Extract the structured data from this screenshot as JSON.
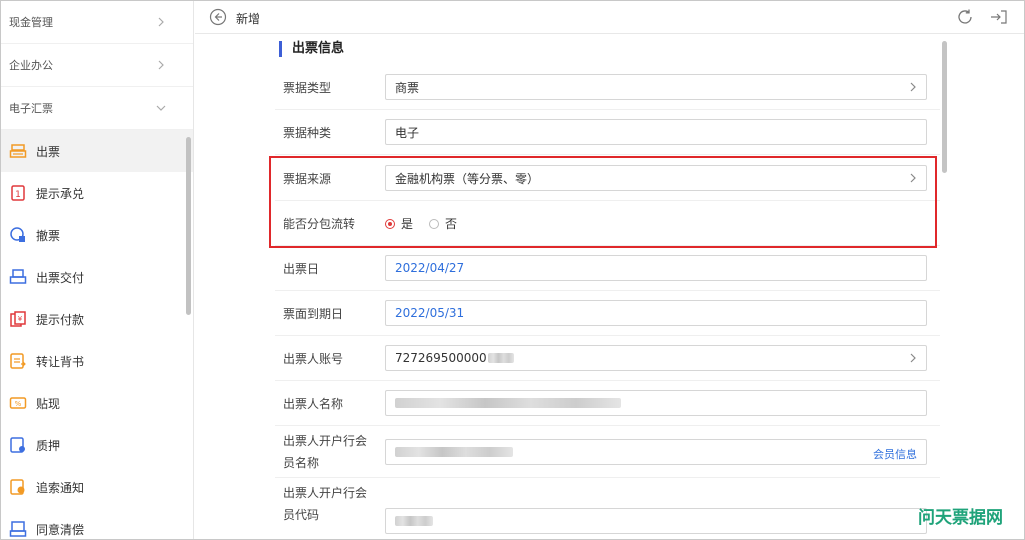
{
  "sidebar": {
    "groups": [
      {
        "label": "现金管理",
        "expanded": false
      },
      {
        "label": "企业办公",
        "expanded": false
      },
      {
        "label": "电子汇票",
        "expanded": true
      }
    ],
    "items": [
      {
        "label": "出票",
        "icon": "issue-bill-icon",
        "active": true
      },
      {
        "label": "提示承兑",
        "icon": "acceptance-prompt-icon",
        "active": false
      },
      {
        "label": "撤票",
        "icon": "revoke-bill-icon",
        "active": false
      },
      {
        "label": "出票交付",
        "icon": "bill-delivery-icon",
        "active": false
      },
      {
        "label": "提示付款",
        "icon": "payment-prompt-icon",
        "active": false
      },
      {
        "label": "转让背书",
        "icon": "endorsement-icon",
        "active": false
      },
      {
        "label": "贴现",
        "icon": "discount-icon",
        "active": false
      },
      {
        "label": "质押",
        "icon": "pledge-icon",
        "active": false
      },
      {
        "label": "追索通知",
        "icon": "recourse-notice-icon",
        "active": false
      },
      {
        "label": "同意清偿",
        "icon": "agree-settlement-icon",
        "active": false
      }
    ]
  },
  "header": {
    "title": "新增"
  },
  "form": {
    "section_title": "出票信息",
    "bill_type": {
      "label": "票据类型",
      "value": "商票"
    },
    "bill_kind": {
      "label": "票据种类",
      "value": "电子"
    },
    "bill_source": {
      "label": "票据来源",
      "value": "金融机构票（等分票、零）"
    },
    "split_transfer": {
      "label": "能否分包流转",
      "options": [
        "是",
        "否"
      ],
      "selected": "是"
    },
    "issue_date": {
      "label": "出票日",
      "value": "2022/04/27"
    },
    "due_date": {
      "label": "票面到期日",
      "value": "2022/05/31"
    },
    "drawer_account": {
      "label": "出票人账号",
      "value": "727269500000"
    },
    "drawer_name": {
      "label": "出票人名称"
    },
    "drawer_bank_member_name": {
      "label_line1": "出票人开户行会",
      "label_line2": "员名称",
      "link": "会员信息"
    },
    "drawer_bank_member_code": {
      "label_line1": "出票人开户行会",
      "label_line2": "员代码"
    }
  },
  "watermark": "问天票据网",
  "colors": {
    "accent": "#3d5fd6",
    "highlight": "#e0282b",
    "link": "#2f6fdc",
    "watermark": "#1fa37a"
  }
}
